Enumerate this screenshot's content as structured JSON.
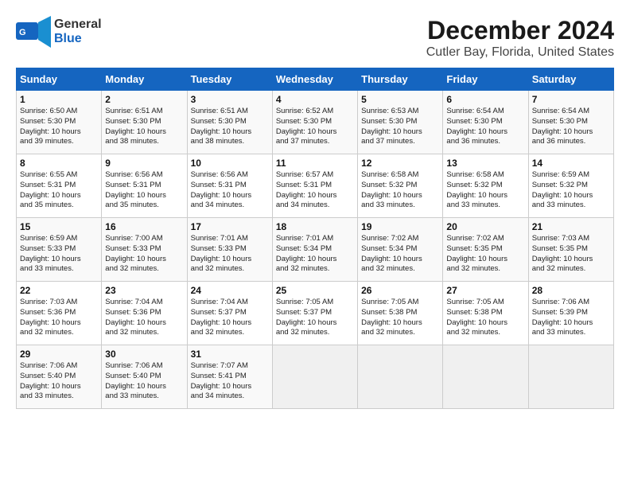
{
  "header": {
    "logo_line1": "General",
    "logo_line2": "Blue",
    "title": "December 2024",
    "subtitle": "Cutler Bay, Florida, United States"
  },
  "calendar": {
    "days_of_week": [
      "Sunday",
      "Monday",
      "Tuesday",
      "Wednesday",
      "Thursday",
      "Friday",
      "Saturday"
    ],
    "weeks": [
      [
        {
          "day": "",
          "info": ""
        },
        {
          "day": "2",
          "info": "Sunrise: 6:51 AM\nSunset: 5:30 PM\nDaylight: 10 hours\nand 38 minutes."
        },
        {
          "day": "3",
          "info": "Sunrise: 6:51 AM\nSunset: 5:30 PM\nDaylight: 10 hours\nand 38 minutes."
        },
        {
          "day": "4",
          "info": "Sunrise: 6:52 AM\nSunset: 5:30 PM\nDaylight: 10 hours\nand 37 minutes."
        },
        {
          "day": "5",
          "info": "Sunrise: 6:53 AM\nSunset: 5:30 PM\nDaylight: 10 hours\nand 37 minutes."
        },
        {
          "day": "6",
          "info": "Sunrise: 6:54 AM\nSunset: 5:30 PM\nDaylight: 10 hours\nand 36 minutes."
        },
        {
          "day": "7",
          "info": "Sunrise: 6:54 AM\nSunset: 5:30 PM\nDaylight: 10 hours\nand 36 minutes."
        }
      ],
      [
        {
          "day": "8",
          "info": "Sunrise: 6:55 AM\nSunset: 5:31 PM\nDaylight: 10 hours\nand 35 minutes."
        },
        {
          "day": "9",
          "info": "Sunrise: 6:56 AM\nSunset: 5:31 PM\nDaylight: 10 hours\nand 35 minutes."
        },
        {
          "day": "10",
          "info": "Sunrise: 6:56 AM\nSunset: 5:31 PM\nDaylight: 10 hours\nand 34 minutes."
        },
        {
          "day": "11",
          "info": "Sunrise: 6:57 AM\nSunset: 5:31 PM\nDaylight: 10 hours\nand 34 minutes."
        },
        {
          "day": "12",
          "info": "Sunrise: 6:58 AM\nSunset: 5:32 PM\nDaylight: 10 hours\nand 33 minutes."
        },
        {
          "day": "13",
          "info": "Sunrise: 6:58 AM\nSunset: 5:32 PM\nDaylight: 10 hours\nand 33 minutes."
        },
        {
          "day": "14",
          "info": "Sunrise: 6:59 AM\nSunset: 5:32 PM\nDaylight: 10 hours\nand 33 minutes."
        }
      ],
      [
        {
          "day": "15",
          "info": "Sunrise: 6:59 AM\nSunset: 5:33 PM\nDaylight: 10 hours\nand 33 minutes."
        },
        {
          "day": "16",
          "info": "Sunrise: 7:00 AM\nSunset: 5:33 PM\nDaylight: 10 hours\nand 32 minutes."
        },
        {
          "day": "17",
          "info": "Sunrise: 7:01 AM\nSunset: 5:33 PM\nDaylight: 10 hours\nand 32 minutes."
        },
        {
          "day": "18",
          "info": "Sunrise: 7:01 AM\nSunset: 5:34 PM\nDaylight: 10 hours\nand 32 minutes."
        },
        {
          "day": "19",
          "info": "Sunrise: 7:02 AM\nSunset: 5:34 PM\nDaylight: 10 hours\nand 32 minutes."
        },
        {
          "day": "20",
          "info": "Sunrise: 7:02 AM\nSunset: 5:35 PM\nDaylight: 10 hours\nand 32 minutes."
        },
        {
          "day": "21",
          "info": "Sunrise: 7:03 AM\nSunset: 5:35 PM\nDaylight: 10 hours\nand 32 minutes."
        }
      ],
      [
        {
          "day": "22",
          "info": "Sunrise: 7:03 AM\nSunset: 5:36 PM\nDaylight: 10 hours\nand 32 minutes."
        },
        {
          "day": "23",
          "info": "Sunrise: 7:04 AM\nSunset: 5:36 PM\nDaylight: 10 hours\nand 32 minutes."
        },
        {
          "day": "24",
          "info": "Sunrise: 7:04 AM\nSunset: 5:37 PM\nDaylight: 10 hours\nand 32 minutes."
        },
        {
          "day": "25",
          "info": "Sunrise: 7:05 AM\nSunset: 5:37 PM\nDaylight: 10 hours\nand 32 minutes."
        },
        {
          "day": "26",
          "info": "Sunrise: 7:05 AM\nSunset: 5:38 PM\nDaylight: 10 hours\nand 32 minutes."
        },
        {
          "day": "27",
          "info": "Sunrise: 7:05 AM\nSunset: 5:38 PM\nDaylight: 10 hours\nand 32 minutes."
        },
        {
          "day": "28",
          "info": "Sunrise: 7:06 AM\nSunset: 5:39 PM\nDaylight: 10 hours\nand 33 minutes."
        }
      ],
      [
        {
          "day": "29",
          "info": "Sunrise: 7:06 AM\nSunset: 5:40 PM\nDaylight: 10 hours\nand 33 minutes."
        },
        {
          "day": "30",
          "info": "Sunrise: 7:06 AM\nSunset: 5:40 PM\nDaylight: 10 hours\nand 33 minutes."
        },
        {
          "day": "31",
          "info": "Sunrise: 7:07 AM\nSunset: 5:41 PM\nDaylight: 10 hours\nand 34 minutes."
        },
        {
          "day": "",
          "info": ""
        },
        {
          "day": "",
          "info": ""
        },
        {
          "day": "",
          "info": ""
        },
        {
          "day": "",
          "info": ""
        }
      ]
    ],
    "week0_day1": {
      "day": "1",
      "info": "Sunrise: 6:50 AM\nSunset: 5:30 PM\nDaylight: 10 hours\nand 39 minutes."
    }
  }
}
